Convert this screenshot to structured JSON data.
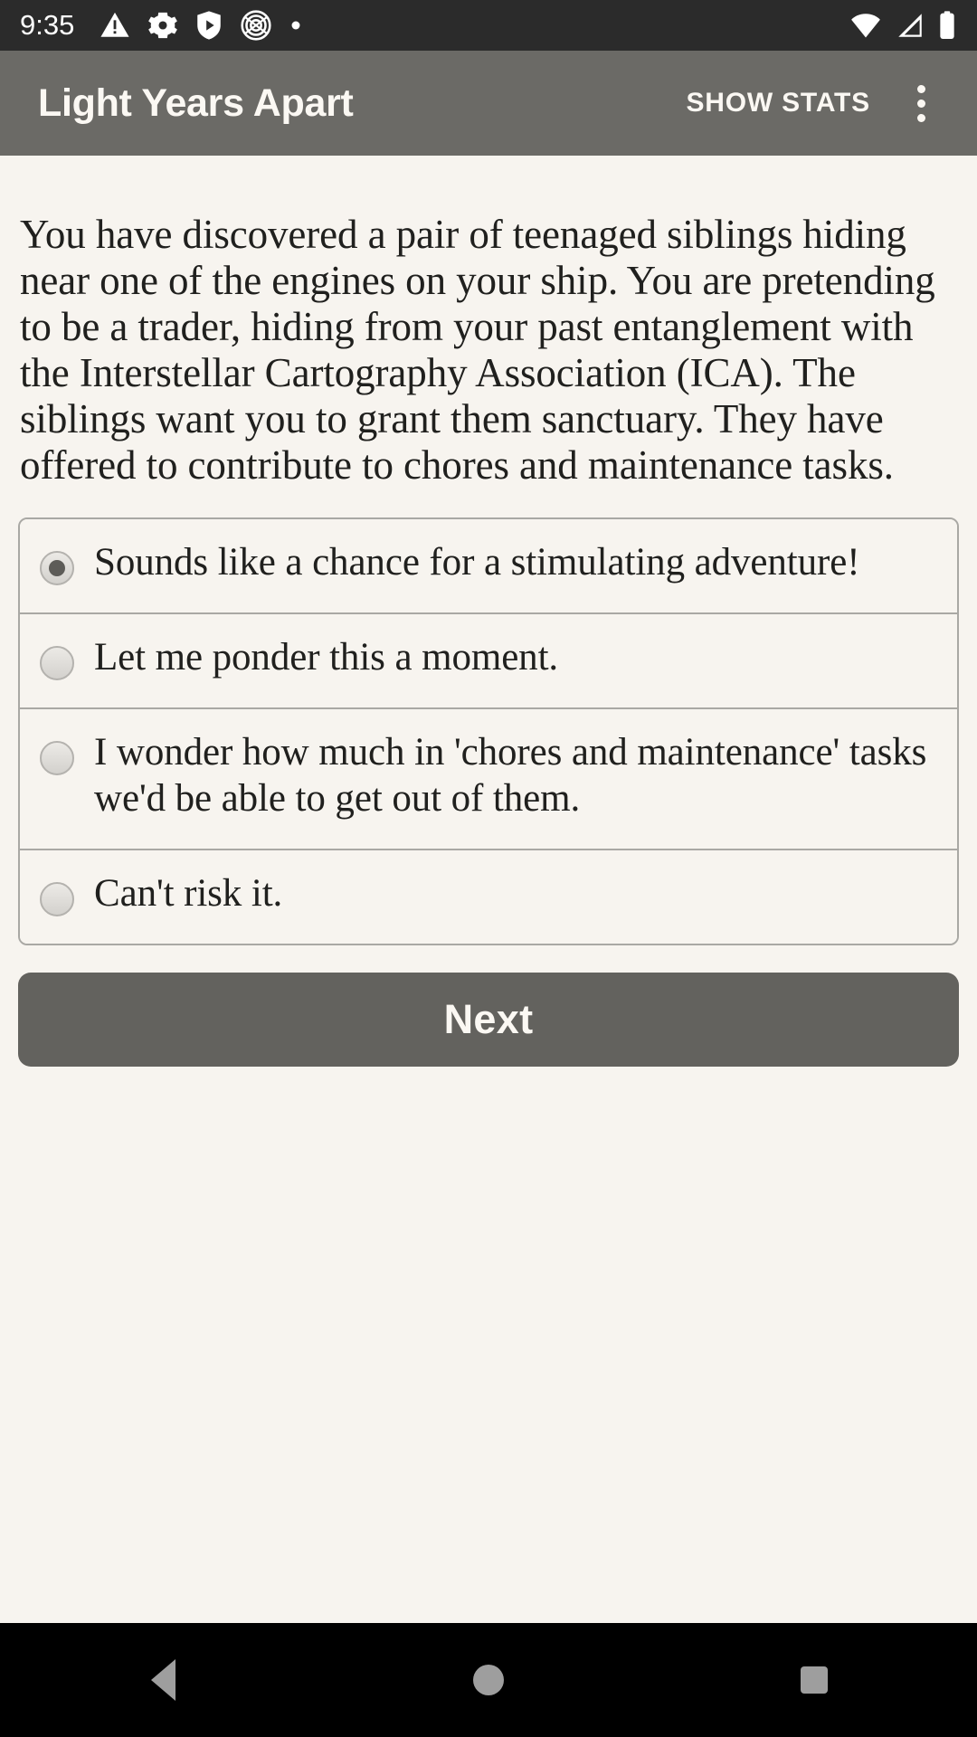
{
  "status_bar": {
    "time": "9:35",
    "left_icons": [
      "warning-triangle-icon",
      "gear-icon",
      "shield-play-icon",
      "fingerprint-icon",
      "dot-icon"
    ],
    "right_icons": [
      "wifi-icon",
      "cellular-signal-icon",
      "battery-icon"
    ]
  },
  "app_bar": {
    "title": "Light Years Apart",
    "show_stats_label": "SHOW STATS",
    "overflow_label": "more-options"
  },
  "main": {
    "story_text": "You have discovered a pair of teenaged siblings hiding near one of the engines on your ship. You are pretending to be a trader, hiding from your past entanglement with the Interstellar Cartography Association (ICA). The siblings want you to grant them sanctuary. They have offered to contribute to chores and maintenance tasks.",
    "options": [
      {
        "label": "Sounds like a chance for a stimulating adventure!",
        "selected": true
      },
      {
        "label": "Let me ponder this a moment.",
        "selected": false
      },
      {
        "label": "I wonder how much in 'chores and maintenance' tasks we'd be able to get out of them.",
        "selected": false
      },
      {
        "label": "Can't risk it.",
        "selected": false
      }
    ],
    "next_label": "Next"
  },
  "nav_bar": {
    "back_label": "back",
    "home_label": "home",
    "recents_label": "recents"
  },
  "colors": {
    "background": "#f7f4ef",
    "app_bar": "#6b6a66",
    "status_bar": "#2b2b2b",
    "text": "#20201e",
    "border": "#a9a8a4",
    "button": "#63625e",
    "nav_bar": "#000000"
  }
}
